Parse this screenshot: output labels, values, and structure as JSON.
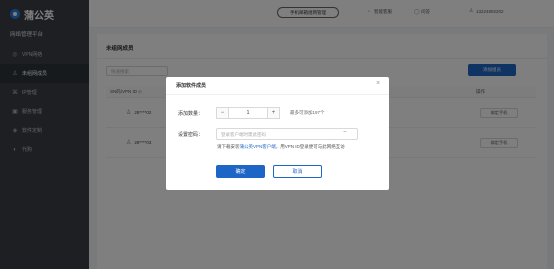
{
  "brand": {
    "name": "蒲公英"
  },
  "sidebar": {
    "platform_title": "网络管理平台",
    "items": [
      {
        "label": "VPN网络",
        "icon": "globe-icon"
      },
      {
        "label": "未组网成员",
        "icon": "user-icon"
      },
      {
        "label": "IP管理",
        "icon": "ip-icon"
      },
      {
        "label": "服务管理",
        "icon": "service-icon"
      },
      {
        "label": "软件定制",
        "icon": "software-icon"
      },
      {
        "label": "代购",
        "icon": "cart-icon"
      }
    ]
  },
  "header": {
    "pill_button": "手机邮箱组网管理",
    "items": [
      {
        "label": "智能客服",
        "icon": "headset-icon"
      },
      {
        "label": "问答",
        "icon": "help-icon"
      },
      {
        "label": "13224892202",
        "icon": "user-icon"
      }
    ]
  },
  "main": {
    "title": "未组网成员",
    "search_placeholder": "快速搜索",
    "add_button": "添加组员",
    "columns": {
      "id": "SN码/VPN ID ◇",
      "operation": "操作"
    },
    "rows": [
      {
        "user": "28****02",
        "action": "绑定手机"
      },
      {
        "user": "28****03",
        "action": "绑定手机"
      }
    ]
  },
  "modal": {
    "title": "添加软件成员",
    "close": "×",
    "quantity_label": "添加数量：",
    "quantity_value": "1",
    "quantity_limit": "最多可添加197个",
    "password_label": "设置密码：",
    "password_placeholder": "登录客户端时需此密码",
    "hint_prefix": "请下载安装",
    "hint_link": "蒲公英VPN客户端",
    "hint_suffix": "，用VPN ID登录便可与此网络互访",
    "ok_button": "确定",
    "cancel_button": "取消"
  },
  "colors": {
    "accent": "#1e66c6",
    "sidebar": "#3a3f47",
    "overlay": "rgba(0,0,0,0.5)"
  }
}
